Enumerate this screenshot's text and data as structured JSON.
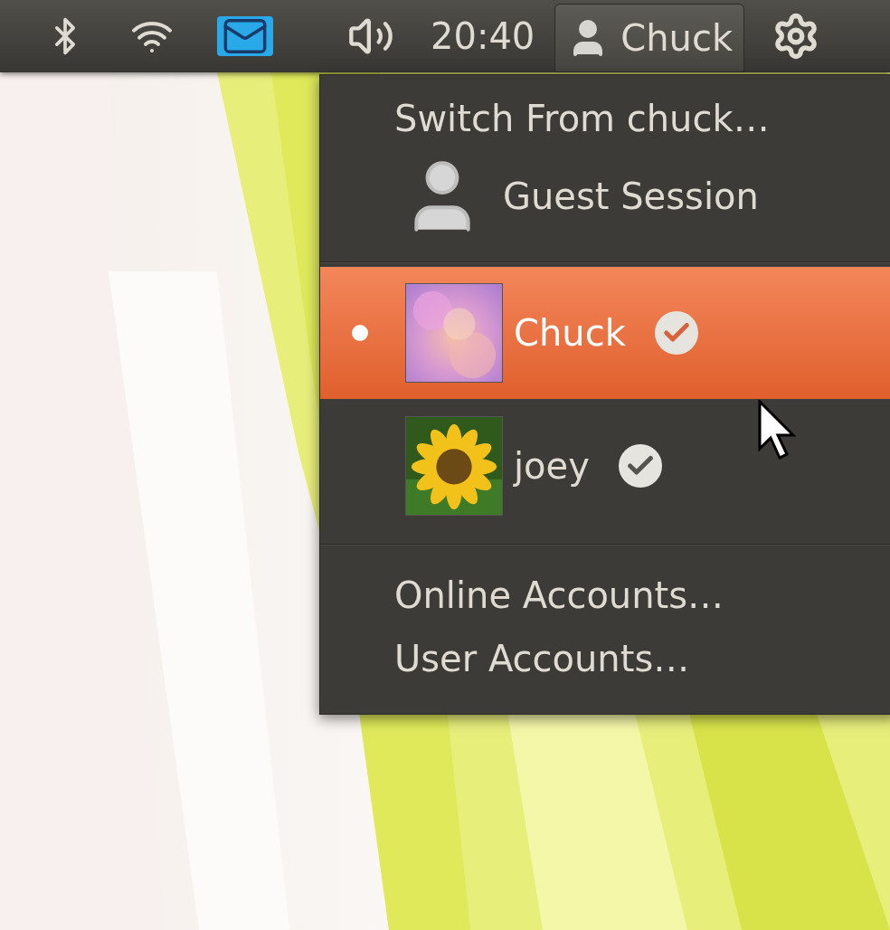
{
  "panel": {
    "clock": "20:40",
    "user_button": {
      "label": "Chuck",
      "selected": true
    }
  },
  "menu": {
    "switch_label": "Switch From chuck…",
    "guest": {
      "label": "Guest Session"
    },
    "users": [
      {
        "name": "Chuck",
        "selected": true,
        "current": true,
        "logged_in": true
      },
      {
        "name": "joey",
        "selected": false,
        "current": false,
        "logged_in": true
      }
    ],
    "actions": [
      "Online Accounts…",
      "User Accounts…"
    ]
  }
}
